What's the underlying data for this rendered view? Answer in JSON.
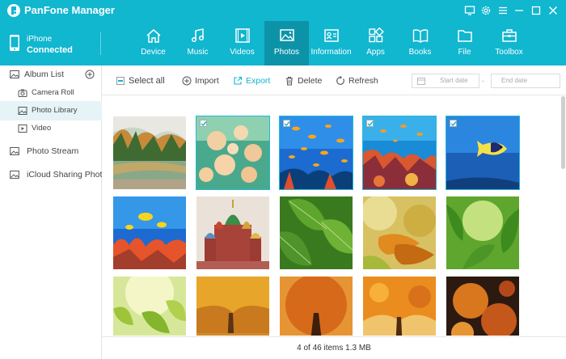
{
  "app": {
    "title": "PanFone Manager"
  },
  "device": {
    "name": "iPhone",
    "status": "Connected"
  },
  "nav": [
    {
      "label": "Device",
      "icon": "home-icon"
    },
    {
      "label": "Music",
      "icon": "music-icon"
    },
    {
      "label": "Videos",
      "icon": "video-icon"
    },
    {
      "label": "Photos",
      "icon": "photo-icon",
      "active": true
    },
    {
      "label": "Information",
      "icon": "contact-card-icon"
    },
    {
      "label": "Apps",
      "icon": "apps-icon"
    },
    {
      "label": "Books",
      "icon": "book-icon"
    },
    {
      "label": "File",
      "icon": "folder-icon"
    },
    {
      "label": "Toolbox",
      "icon": "toolbox-icon"
    }
  ],
  "sidebar": {
    "album_list": "Album List",
    "items": [
      {
        "label": "Camera Roll",
        "icon": "camera-icon"
      },
      {
        "label": "Photo Library",
        "icon": "image-icon",
        "active": true
      },
      {
        "label": "Video",
        "icon": "play-icon"
      }
    ],
    "photo_stream": "Photo Stream",
    "icloud": "iCloud Sharing Photo"
  },
  "toolbar": {
    "select_all": "Select all",
    "import": "Import",
    "export": "Export",
    "delete": "Delete",
    "refresh": "Refresh",
    "start_date": "Start date",
    "end_date": "End date",
    "date_separator": "-"
  },
  "photos": [
    {
      "name": "lake-forest",
      "selected": false
    },
    {
      "name": "jellyfish",
      "selected": true
    },
    {
      "name": "coral-fish",
      "selected": true
    },
    {
      "name": "coral-reef",
      "selected": true
    },
    {
      "name": "underwater-fish",
      "selected": true
    },
    {
      "name": "reef-fish",
      "selected": false
    },
    {
      "name": "cathedral",
      "selected": false
    },
    {
      "name": "green-leaves",
      "selected": false
    },
    {
      "name": "autumn-leaves-blur",
      "selected": false
    },
    {
      "name": "green-leaves-sun",
      "selected": false
    },
    {
      "name": "sunlight-leaves",
      "selected": false
    },
    {
      "name": "autumn-road",
      "selected": false
    },
    {
      "name": "autumn-tree",
      "selected": false
    },
    {
      "name": "autumn-orange-tree",
      "selected": false
    },
    {
      "name": "autumn-dark",
      "selected": false
    }
  ],
  "status": {
    "text": "4 of 46 items 1.3 MB"
  },
  "colors": {
    "accent": "#11b6cf",
    "nav_active": "#0d93a8",
    "selection": "#22b8d8"
  }
}
